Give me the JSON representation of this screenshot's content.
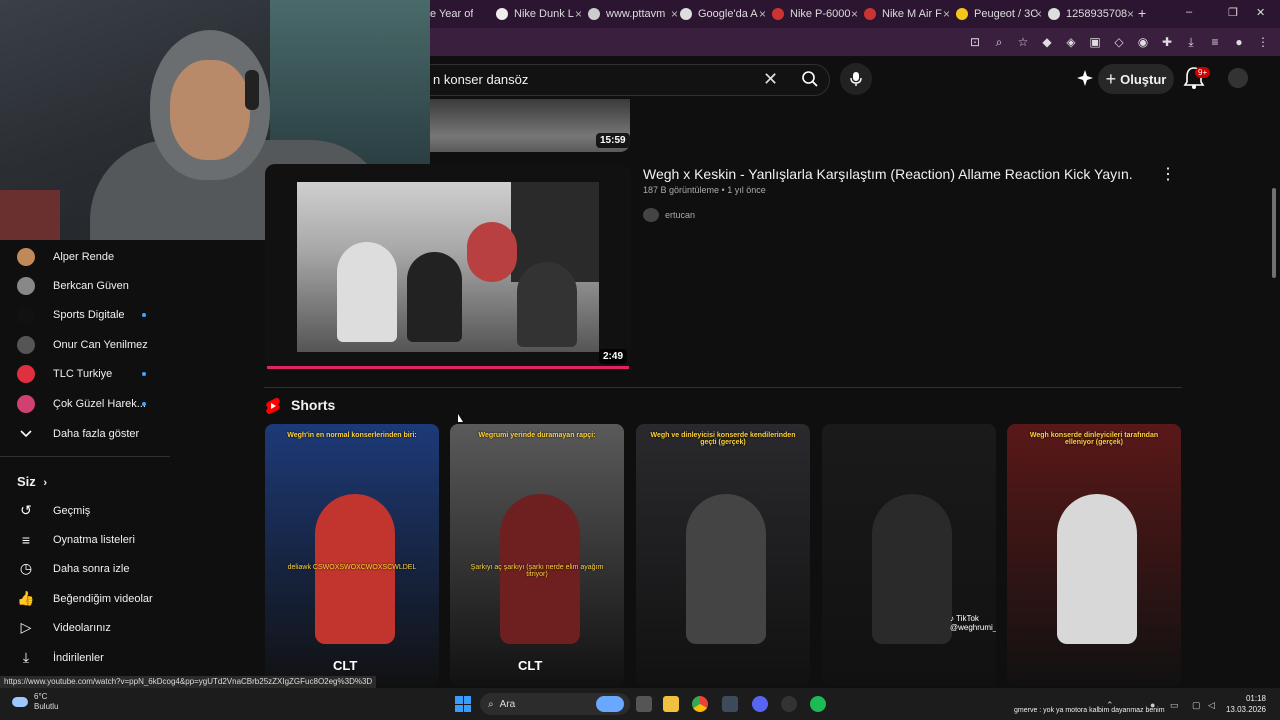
{
  "browser": {
    "tabs": [
      {
        "label": "e Year of",
        "color": "#888888"
      },
      {
        "label": "Nike Dunk L",
        "color": "#eeeeee"
      },
      {
        "label": "www.pttavm",
        "color": "#cccccc"
      },
      {
        "label": "Google'da A",
        "color": "#dddddd"
      },
      {
        "label": "Nike P-6000",
        "color": "#cc3333"
      },
      {
        "label": "Nike M Air F",
        "color": "#cc3333"
      },
      {
        "label": "Peugeot / 3C",
        "color": "#f5c518"
      },
      {
        "label": "1258935708",
        "color": "#dddddd"
      }
    ],
    "tab_close": "×",
    "new_tab": "+",
    "window_controls": [
      "–",
      "❐",
      "✕"
    ]
  },
  "youtube": {
    "search_value": "n konser dansöz",
    "create_label": "Oluştur",
    "notif_count": "9+"
  },
  "sidebar": {
    "channels": [
      {
        "name": "Alper Rende",
        "color": "#c0895a",
        "dot": false
      },
      {
        "name": "Berkcan Güven",
        "color": "#888888",
        "dot": false
      },
      {
        "name": "Sports Digitale",
        "color": "#111111",
        "dot": true
      },
      {
        "name": "Onur Can Yenilmez",
        "color": "#555555",
        "dot": false
      },
      {
        "name": "TLC Turkiye",
        "color": "#e03040",
        "dot": true
      },
      {
        "name": "Çok Güzel Harek...",
        "color": "#d04070",
        "dot": true
      }
    ],
    "show_more": "Daha fazla göster",
    "you_section": "Siz",
    "you_items": [
      {
        "label": "Geçmiş",
        "icon": "history-icon",
        "glyph": "↺"
      },
      {
        "label": "Oynatma listeleri",
        "icon": "playlist-icon",
        "glyph": "≡"
      },
      {
        "label": "Daha sonra izle",
        "icon": "clock-icon",
        "glyph": "◷"
      },
      {
        "label": "Beğendiğim videolar",
        "icon": "thumbs-up-icon",
        "glyph": "👍"
      },
      {
        "label": "Videolarınız",
        "icon": "video-icon",
        "glyph": "▷"
      },
      {
        "label": "İndirilenler",
        "icon": "download-icon",
        "glyph": "⤓"
      }
    ]
  },
  "videos": {
    "top_duration": "15:59",
    "main": {
      "title": "Wegh x Keskin - Yanlışlarla Karşılaştım (Reaction) Allame Reaction Kick Yayın.",
      "meta": "187 B görüntüleme • 1 yıl önce",
      "channel": "ertucan",
      "duration": "2:49"
    }
  },
  "shorts": {
    "heading": "Shorts",
    "items": [
      {
        "caption": "Wegh'in en normal konserlerinden biri:",
        "sub": "deliawk CSWOXSWOXCWOXSCWLDEL",
        "logo": "CLT",
        "tiktok": "",
        "bg": "#1d3a78",
        "fig": "#c2352e"
      },
      {
        "caption": "Wegrumi yerinde duramayan rapçi:",
        "sub": "Şarkıyı aç şarkıyı (şarkı nerde elim ayağım titriyor)",
        "logo": "CLT",
        "tiktok": "",
        "bg": "#5a5a5a",
        "fig": "#6e2020"
      },
      {
        "caption": "Wegh ve dinleyicisi konserde kendilerinden geçti (gerçek)",
        "sub": "",
        "logo": "",
        "tiktok": "",
        "bg": "#2a2a2e",
        "fig": "#444444"
      },
      {
        "caption": "",
        "sub": "",
        "logo": "",
        "tiktok": "♪ TikTok @weghrumi_",
        "bg": "#1a1a1a",
        "fig": "#2a2a2a"
      },
      {
        "caption": "Wegh konserde dinleyicileri tarafından elleniyor (gerçek)",
        "sub": "",
        "logo": "",
        "tiktok": "",
        "bg": "#5a1818",
        "fig": "#d8d8d8"
      }
    ]
  },
  "status_url": "https://www.youtube.com/watch?v=ppN_6kDcog4&pp=ygUTd2VnaCBrb25zZXIgZGFuc8O2eg%3D%3D",
  "taskbar": {
    "temp": "6°C",
    "weather": "Bulutlu",
    "search": "Ara",
    "now_playing": "gmerve : yok ya motora kalbim dayanmaz benim",
    "time": "01:18",
    "date": "13.03.2026"
  }
}
